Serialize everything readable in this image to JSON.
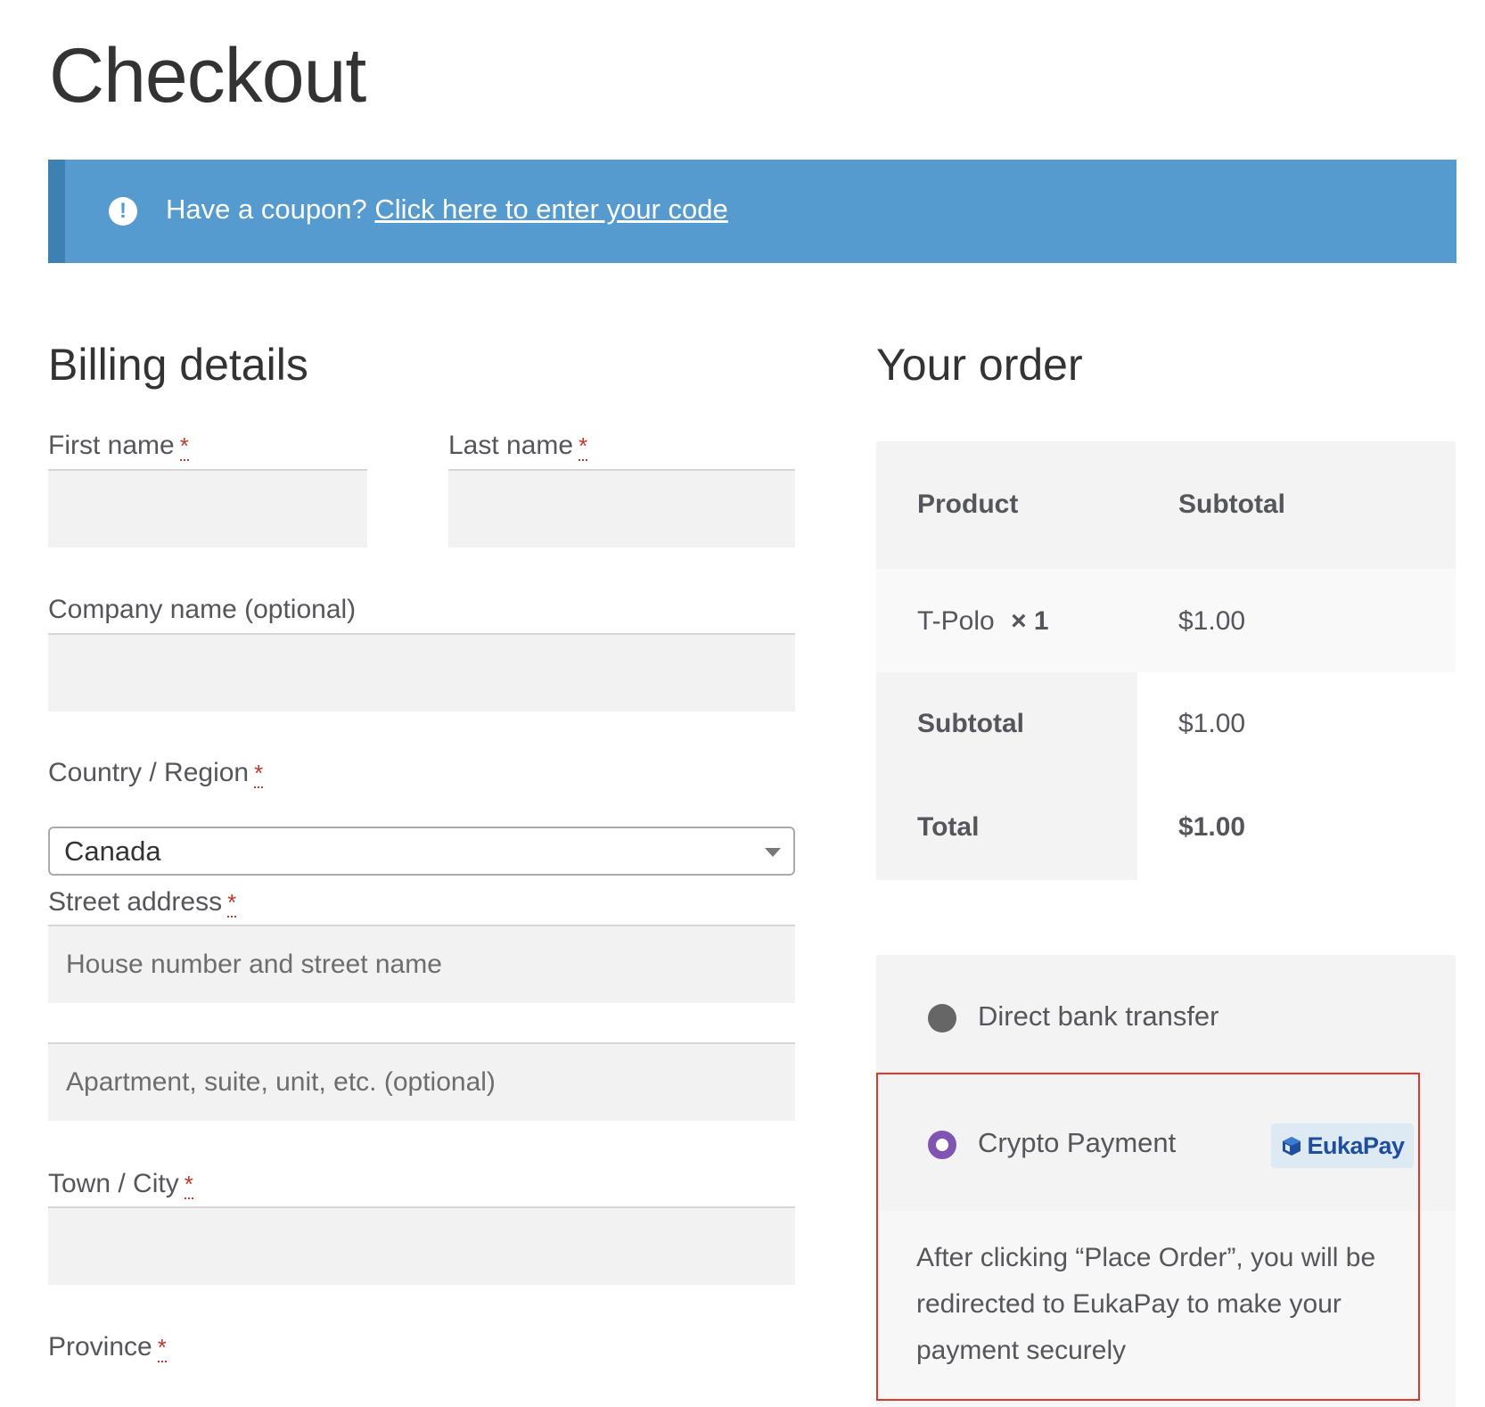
{
  "page": {
    "title": "Checkout"
  },
  "notice": {
    "text": "Have a coupon?",
    "link": "Click here to enter your code"
  },
  "billing": {
    "heading": "Billing details",
    "required_mark": "*",
    "first_name_label": "First name",
    "last_name_label": "Last name",
    "company_label": "Company name (optional)",
    "country_label": "Country / Region",
    "country_value": "Canada",
    "street_label": "Street address",
    "street_placeholder": "House number and street name",
    "apartment_placeholder": "Apartment, suite, unit, etc. (optional)",
    "city_label": "Town / City",
    "province_label": "Province"
  },
  "order": {
    "heading": "Your order",
    "col_product": "Product",
    "col_subtotal": "Subtotal",
    "items": [
      {
        "name": "T-Polo",
        "qty": "× 1",
        "subtotal": "$1.00"
      }
    ],
    "subtotal_label": "Subtotal",
    "subtotal_value": "$1.00",
    "total_label": "Total",
    "total_value": "$1.00"
  },
  "payment": {
    "methods": [
      {
        "label": "Direct bank transfer",
        "selected": false
      },
      {
        "label": "Crypto Payment",
        "selected": true
      }
    ],
    "badge": "EukaPay",
    "description": "After clicking “Place Order”, you will be redirected to EukaPay to make your payment securely"
  },
  "colors": {
    "notice_bg": "#569bcf",
    "highlight_border": "#e0392b",
    "radio_selected": "#7f54b3"
  }
}
